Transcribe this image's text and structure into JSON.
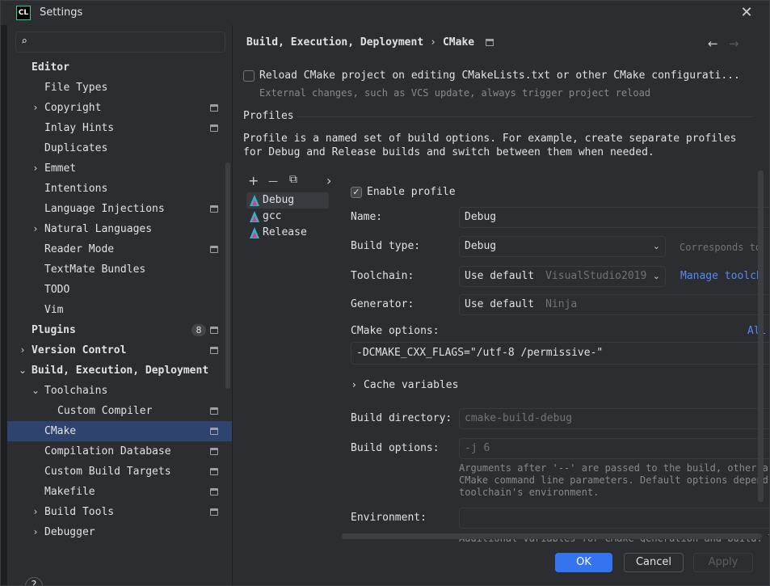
{
  "window": {
    "title": "Settings",
    "logo_text": "CL"
  },
  "search": {
    "placeholder": ""
  },
  "sidebar": {
    "items": [
      {
        "label": "Editor",
        "bold": true,
        "indent": 0,
        "chevron": "",
        "proj": false,
        "badge": ""
      },
      {
        "label": "File Types",
        "bold": false,
        "indent": 1,
        "chevron": "",
        "proj": false,
        "badge": ""
      },
      {
        "label": "Copyright",
        "bold": false,
        "indent": 1,
        "chevron": "›",
        "proj": true,
        "badge": ""
      },
      {
        "label": "Inlay Hints",
        "bold": false,
        "indent": 1,
        "chevron": "",
        "proj": true,
        "badge": ""
      },
      {
        "label": "Duplicates",
        "bold": false,
        "indent": 1,
        "chevron": "",
        "proj": false,
        "badge": ""
      },
      {
        "label": "Emmet",
        "bold": false,
        "indent": 1,
        "chevron": "›",
        "proj": false,
        "badge": ""
      },
      {
        "label": "Intentions",
        "bold": false,
        "indent": 1,
        "chevron": "",
        "proj": false,
        "badge": ""
      },
      {
        "label": "Language Injections",
        "bold": false,
        "indent": 1,
        "chevron": "",
        "proj": true,
        "badge": ""
      },
      {
        "label": "Natural Languages",
        "bold": false,
        "indent": 1,
        "chevron": "›",
        "proj": false,
        "badge": ""
      },
      {
        "label": "Reader Mode",
        "bold": false,
        "indent": 1,
        "chevron": "",
        "proj": true,
        "badge": ""
      },
      {
        "label": "TextMate Bundles",
        "bold": false,
        "indent": 1,
        "chevron": "",
        "proj": false,
        "badge": ""
      },
      {
        "label": "TODO",
        "bold": false,
        "indent": 1,
        "chevron": "",
        "proj": false,
        "badge": ""
      },
      {
        "label": "Vim",
        "bold": false,
        "indent": 1,
        "chevron": "",
        "proj": false,
        "badge": ""
      },
      {
        "label": "Plugins",
        "bold": true,
        "indent": 0,
        "chevron": "",
        "proj": true,
        "badge": "8"
      },
      {
        "label": "Version Control",
        "bold": true,
        "indent": 0,
        "chevron": "›",
        "proj": true,
        "badge": ""
      },
      {
        "label": "Build, Execution, Deployment",
        "bold": true,
        "indent": 0,
        "chevron": "⌄",
        "proj": false,
        "badge": ""
      },
      {
        "label": "Toolchains",
        "bold": false,
        "indent": 1,
        "chevron": "⌄",
        "proj": false,
        "badge": ""
      },
      {
        "label": "Custom Compiler",
        "bold": false,
        "indent": 2,
        "chevron": "",
        "proj": true,
        "badge": ""
      },
      {
        "label": "CMake",
        "bold": false,
        "indent": 1,
        "chevron": "",
        "proj": true,
        "badge": "",
        "selected": true
      },
      {
        "label": "Compilation Database",
        "bold": false,
        "indent": 1,
        "chevron": "",
        "proj": true,
        "badge": ""
      },
      {
        "label": "Custom Build Targets",
        "bold": false,
        "indent": 1,
        "chevron": "",
        "proj": true,
        "badge": ""
      },
      {
        "label": "Makefile",
        "bold": false,
        "indent": 1,
        "chevron": "",
        "proj": true,
        "badge": ""
      },
      {
        "label": "Build Tools",
        "bold": false,
        "indent": 1,
        "chevron": "›",
        "proj": true,
        "badge": ""
      },
      {
        "label": "Debugger",
        "bold": false,
        "indent": 1,
        "chevron": "›",
        "proj": false,
        "badge": ""
      }
    ]
  },
  "breadcrumb": {
    "parent": "Build, Execution, Deployment",
    "separator": "›",
    "current": "CMake",
    "back": "←",
    "forward": "→"
  },
  "reload": {
    "label": "Reload CMake project on editing CMakeLists.txt or other CMake configurati...",
    "hint": "External changes, such as VCS update, always trigger project reload",
    "checked": false
  },
  "profiles": {
    "heading": "Profiles",
    "description_line1": "Profile is a named set of build options. For example, create separate profiles",
    "description_line2": "for Debug and Release builds and switch between them when needed.",
    "toolbar": {
      "add": "+",
      "remove": "—",
      "copy": "⧉",
      "more": "›"
    },
    "list": [
      {
        "name": "Debug",
        "selected": true
      },
      {
        "name": "gcc",
        "selected": false
      },
      {
        "name": "Release",
        "selected": false
      }
    ]
  },
  "form": {
    "enable_profile": "Enable profile",
    "enable_checked": true,
    "name_label": "Name:",
    "name_value": "Debug",
    "build_type_label": "Build type:",
    "build_type_value": "Debug",
    "build_type_note": "Corresponds to",
    "toolchain_label": "Toolchain:",
    "toolchain_value": "Use default",
    "toolchain_sub": "VisualStudio2019",
    "manage_toolchains": "Manage toolch",
    "generator_label": "Generator:",
    "generator_value": "Use default",
    "generator_sub": "Ninja",
    "cmake_options_label": "CMake options:",
    "cmake_options_all": "All",
    "cmake_options_value": "-DCMAKE_CXX_FLAGS=\"/utf-8 /permissive-\"",
    "cache_variables": "Cache variables",
    "build_dir_label": "Build directory:",
    "build_dir_placeholder": "cmake-build-debug",
    "build_options_label": "Build options:",
    "build_options_placeholder": "-j 6",
    "build_options_hint1": "Arguments after '--' are passed to the build, other ar",
    "build_options_hint2": "CMake command line parameters. Default options depend",
    "build_options_hint3": "toolchain's environment.",
    "environment_label": "Environment:",
    "environment_hint": "Additional variables for CMake generation and build. T"
  },
  "footer": {
    "ok": "OK",
    "cancel": "Cancel",
    "apply": "Apply",
    "help": "?"
  },
  "colors": {
    "accent": "#3574f0",
    "selection": "#2e436e",
    "background": "#2b2d30"
  }
}
